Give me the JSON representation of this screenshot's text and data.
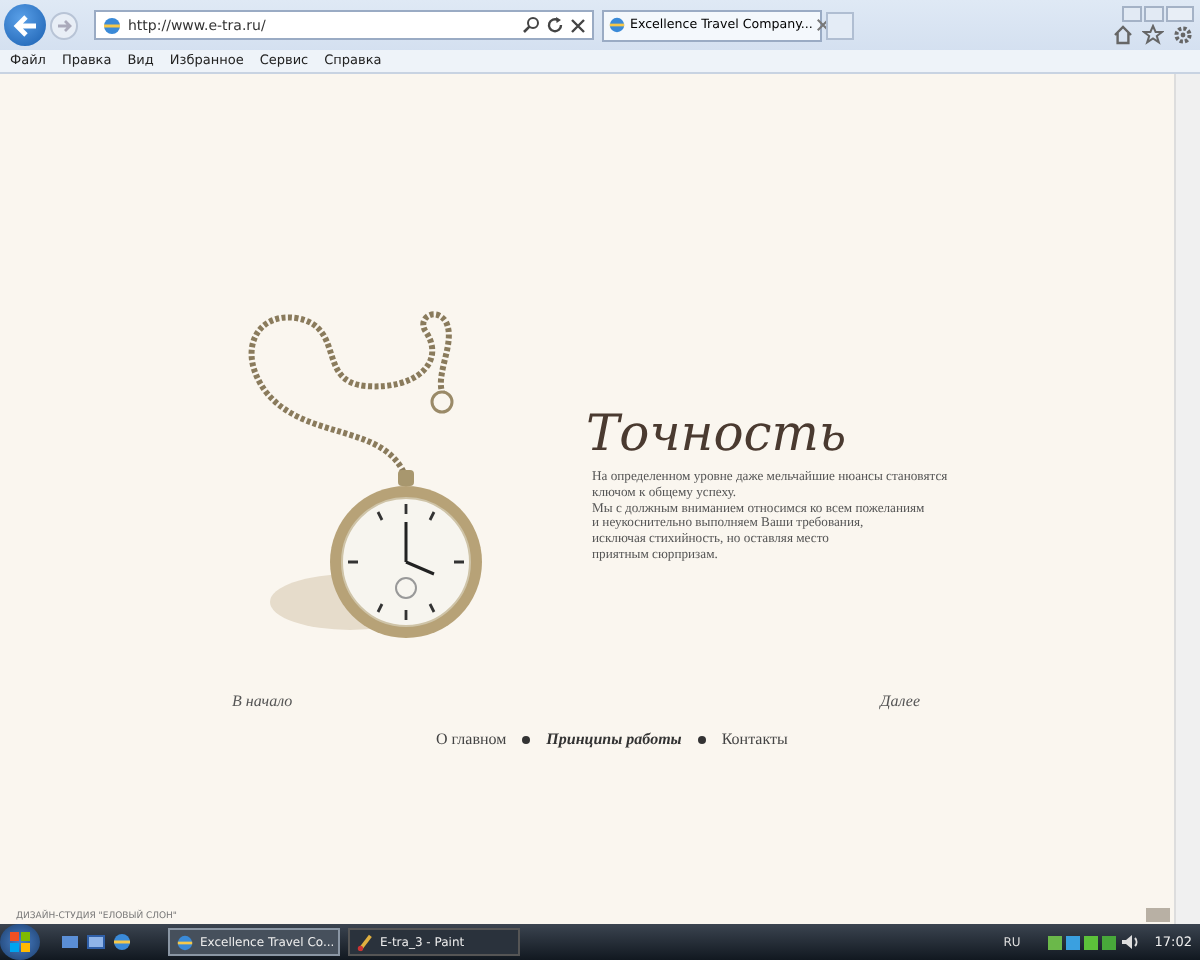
{
  "browser": {
    "address": "http://www.e-tra.ru/",
    "tab_title": "Excellence Travel Company...",
    "menu": [
      "Файл",
      "Правка",
      "Вид",
      "Избранное",
      "Сервис",
      "Справка"
    ]
  },
  "page": {
    "heading": "Точность",
    "paragraph_lines": [
      "На определенном уровне даже мельчайшие нюансы становятся",
      "ключом к общему успеху.",
      "Мы с должным вниманием относимся ко всем пожеланиям",
      "и неукоснительно выполняем Ваши требования,",
      "исключая стихийность, но оставляя место",
      "приятным сюрпризам."
    ],
    "prev_link": "В начало",
    "next_link": "Далее",
    "nav": [
      {
        "label": "О главном",
        "selected": false
      },
      {
        "label": "Принципы работы",
        "selected": true
      },
      {
        "label": "Контакты",
        "selected": false
      }
    ],
    "footer": "ДИЗАЙН-СТУДИЯ \"ЕЛОВЫЙ СЛОН\""
  },
  "taskbar": {
    "buttons": [
      {
        "label": "Excellence Travel Co...",
        "kind": "browser",
        "selected": true
      },
      {
        "label": "E-tra_3 - Paint",
        "kind": "paint",
        "selected": false
      }
    ],
    "language": "RU",
    "clock": "17:02"
  }
}
